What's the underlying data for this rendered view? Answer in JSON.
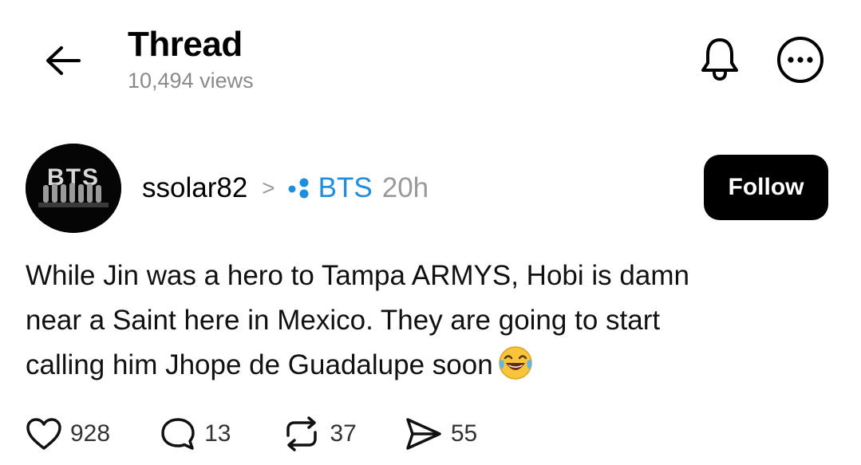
{
  "header": {
    "title": "Thread",
    "views": "10,494 views",
    "icons": [
      "back-arrow-icon",
      "bell-icon",
      "more-options-icon"
    ]
  },
  "post": {
    "avatar_text": "BTS",
    "username": "ssolar82",
    "separator": ">",
    "community": "BTS",
    "community_color": "#1d8ee0",
    "time": "20h",
    "follow_label": "Follow",
    "body_lines": [
      "While Jin was a hero to Tampa ARMYS,  Hobi is damn",
      "near a Saint here in Mexico. They are going to start",
      "calling him Jhope de Guadalupe  soon"
    ],
    "emoji": "face-with-tears-of-joy",
    "actions": {
      "likes": "928",
      "replies": "13",
      "reposts": "37",
      "shares": "55"
    }
  }
}
